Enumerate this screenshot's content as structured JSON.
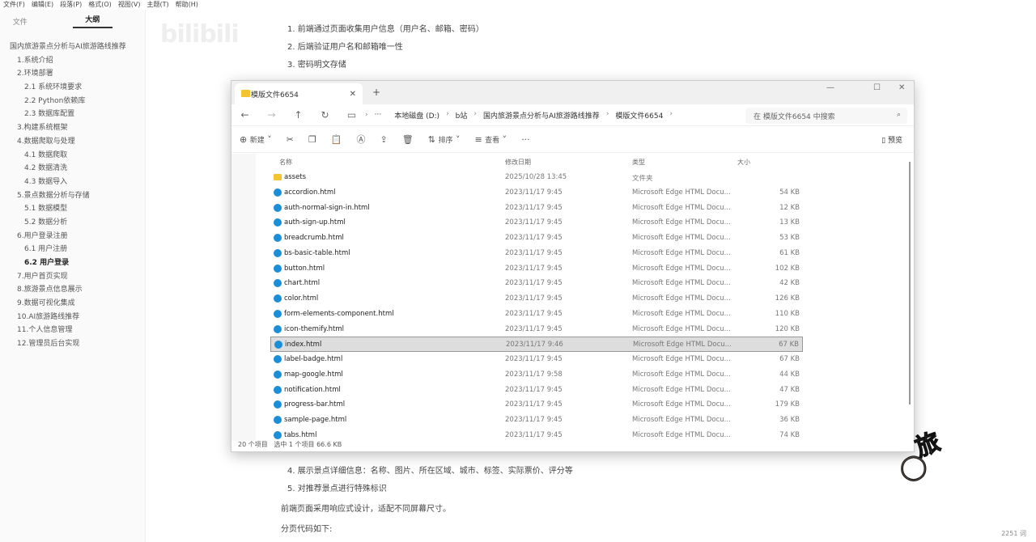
{
  "menu": [
    "文件(F)",
    "编辑(E)",
    "段落(P)",
    "格式(O)",
    "视图(V)",
    "主题(T)",
    "帮助(H)"
  ],
  "sidebar": {
    "tabs": [
      "文件",
      "大纲"
    ],
    "outline": [
      {
        "t": "国内旅游景点分析与AI旅游路线推荐",
        "l": 0
      },
      {
        "t": "1.系统介绍",
        "l": 1
      },
      {
        "t": "2.环境部署",
        "l": 1
      },
      {
        "t": "2.1 系统环境要求",
        "l": 2
      },
      {
        "t": "2.2 Python依赖库",
        "l": 2
      },
      {
        "t": "2.3 数据库配置",
        "l": 2
      },
      {
        "t": "3.构建系统框架",
        "l": 1
      },
      {
        "t": "4.数据爬取与处理",
        "l": 1
      },
      {
        "t": "4.1 数据爬取",
        "l": 2
      },
      {
        "t": "4.2 数据清洗",
        "l": 2
      },
      {
        "t": "4.3 数据导入",
        "l": 2
      },
      {
        "t": "5.景点数据分析与存储",
        "l": 1
      },
      {
        "t": "5.1 数据模型",
        "l": 2
      },
      {
        "t": "5.2 数据分析",
        "l": 2
      },
      {
        "t": "6.用户登录注册",
        "l": 1
      },
      {
        "t": "6.1 用户注册",
        "l": 2
      },
      {
        "t": "6.2 用户登录",
        "l": 2,
        "b": true
      },
      {
        "t": "7.用户首页实现",
        "l": 1
      },
      {
        "t": "8.旅游景点信息展示",
        "l": 1
      },
      {
        "t": "9.数据可视化集成",
        "l": 1
      },
      {
        "t": "10.AI旅游路线推荐",
        "l": 1
      },
      {
        "t": "11.个人信息管理",
        "l": 1
      },
      {
        "t": "12.管理员后台实现",
        "l": 1
      }
    ]
  },
  "watermark": "bilibili",
  "doc": {
    "top": [
      "1. 前端通过页面收集用户信息（用户名、邮箱、密码）",
      "2. 后端验证用户名和邮箱唯一性",
      "3. 密码明文存储"
    ],
    "bottom": [
      "4. 展示景点详细信息：名称、图片、所在区域、城市、标签、实际票价、评分等",
      "5. 对推荐景点进行特殊标识",
      "前端页面采用响应式设计，适配不同屏幕尺寸。",
      "分页代码如下:"
    ],
    "word_count": "2251 词"
  },
  "explorer": {
    "tab_title": "模版文件6654",
    "breadcrumb": [
      "本地磁盘 (D:)",
      "b站",
      "国内旅游景点分析与AI旅游路线推荐",
      "模版文件6654"
    ],
    "search_placeholder": "在 模版文件6654 中搜索",
    "toolbar": {
      "new": "新建",
      "sort": "排序",
      "view": "查看",
      "preview": "预览"
    },
    "columns": [
      "名称",
      "修改日期",
      "类型",
      "大小"
    ],
    "files": [
      {
        "n": "assets",
        "d": "2025/10/28 13:45",
        "t": "文件夹",
        "s": "",
        "folder": true
      },
      {
        "n": "accordion.html",
        "d": "2023/11/17 9:45",
        "t": "Microsoft Edge HTML Docu...",
        "s": "54 KB"
      },
      {
        "n": "auth-normal-sign-in.html",
        "d": "2023/11/17 9:45",
        "t": "Microsoft Edge HTML Docu...",
        "s": "12 KB"
      },
      {
        "n": "auth-sign-up.html",
        "d": "2023/11/17 9:45",
        "t": "Microsoft Edge HTML Docu...",
        "s": "13 KB"
      },
      {
        "n": "breadcrumb.html",
        "d": "2023/11/17 9:45",
        "t": "Microsoft Edge HTML Docu...",
        "s": "53 KB"
      },
      {
        "n": "bs-basic-table.html",
        "d": "2023/11/17 9:45",
        "t": "Microsoft Edge HTML Docu...",
        "s": "61 KB"
      },
      {
        "n": "button.html",
        "d": "2023/11/17 9:45",
        "t": "Microsoft Edge HTML Docu...",
        "s": "102 KB"
      },
      {
        "n": "chart.html",
        "d": "2023/11/17 9:45",
        "t": "Microsoft Edge HTML Docu...",
        "s": "42 KB"
      },
      {
        "n": "color.html",
        "d": "2023/11/17 9:45",
        "t": "Microsoft Edge HTML Docu...",
        "s": "126 KB"
      },
      {
        "n": "form-elements-component.html",
        "d": "2023/11/17 9:45",
        "t": "Microsoft Edge HTML Docu...",
        "s": "110 KB"
      },
      {
        "n": "icon-themify.html",
        "d": "2023/11/17 9:45",
        "t": "Microsoft Edge HTML Docu...",
        "s": "120 KB"
      },
      {
        "n": "index.html",
        "d": "2023/11/17 9:46",
        "t": "Microsoft Edge HTML Docu...",
        "s": "67 KB",
        "sel": true
      },
      {
        "n": "label-badge.html",
        "d": "2023/11/17 9:45",
        "t": "Microsoft Edge HTML Docu...",
        "s": "67 KB"
      },
      {
        "n": "map-google.html",
        "d": "2023/11/17 9:58",
        "t": "Microsoft Edge HTML Docu...",
        "s": "44 KB"
      },
      {
        "n": "notification.html",
        "d": "2023/11/17 9:45",
        "t": "Microsoft Edge HTML Docu...",
        "s": "47 KB"
      },
      {
        "n": "progress-bar.html",
        "d": "2023/11/17 9:45",
        "t": "Microsoft Edge HTML Docu...",
        "s": "179 KB"
      },
      {
        "n": "sample-page.html",
        "d": "2023/11/17 9:45",
        "t": "Microsoft Edge HTML Docu...",
        "s": "36 KB"
      },
      {
        "n": "tabs.html",
        "d": "2023/11/17 9:45",
        "t": "Microsoft Edge HTML Docu...",
        "s": "74 KB"
      }
    ],
    "status": {
      "count": "20 个项目",
      "selected": "选中 1 个项目  66.6 KB"
    }
  }
}
